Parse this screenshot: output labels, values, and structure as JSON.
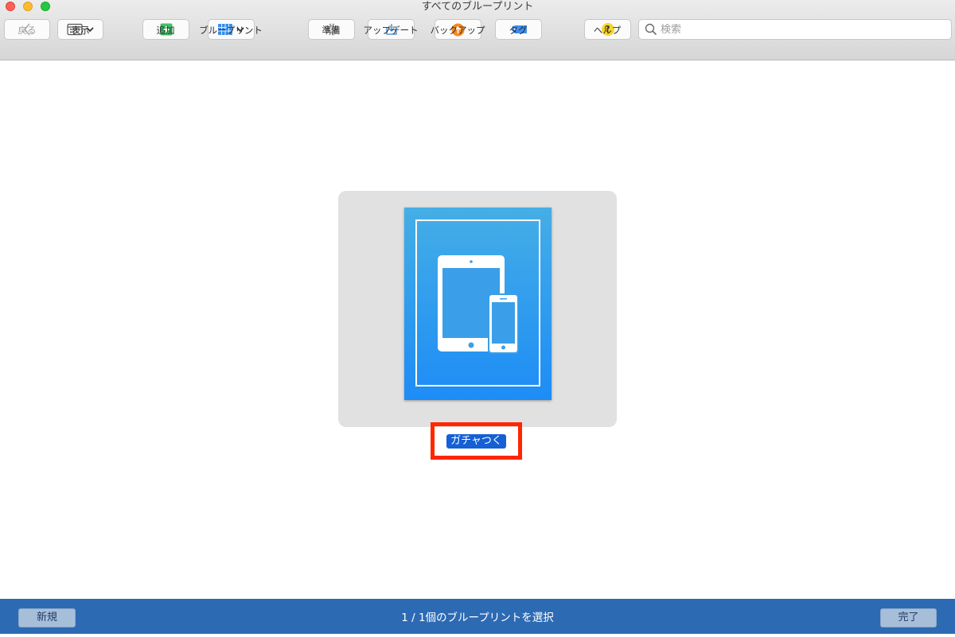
{
  "window": {
    "title": "すべてのブループリント"
  },
  "toolbar": {
    "back_label": "戻る",
    "view_label": "表示",
    "add_label": "追加",
    "blueprint_label": "ブループリント",
    "prepare_label": "準備",
    "update_label": "アップデート",
    "backup_label": "バックアップ",
    "tag_label": "タグ",
    "help_label": "ヘルプ",
    "help_glyph": "?",
    "search_placeholder": "検索"
  },
  "content": {
    "blueprints": [
      {
        "name": "ガチャつく",
        "selected": true
      }
    ]
  },
  "bottom_bar": {
    "new_label": "新規",
    "status": "1 / 1個のブループリントを選択",
    "done_label": "完了"
  },
  "colors": {
    "accent": "#1560d4",
    "bottom_bar": "#2d6ab4",
    "highlight": "#ff2600",
    "add_green": "#3fc465",
    "backup_orange": "#f5881f",
    "tag_blue": "#3e8ef0",
    "help_yellow": "#f8d52b"
  }
}
